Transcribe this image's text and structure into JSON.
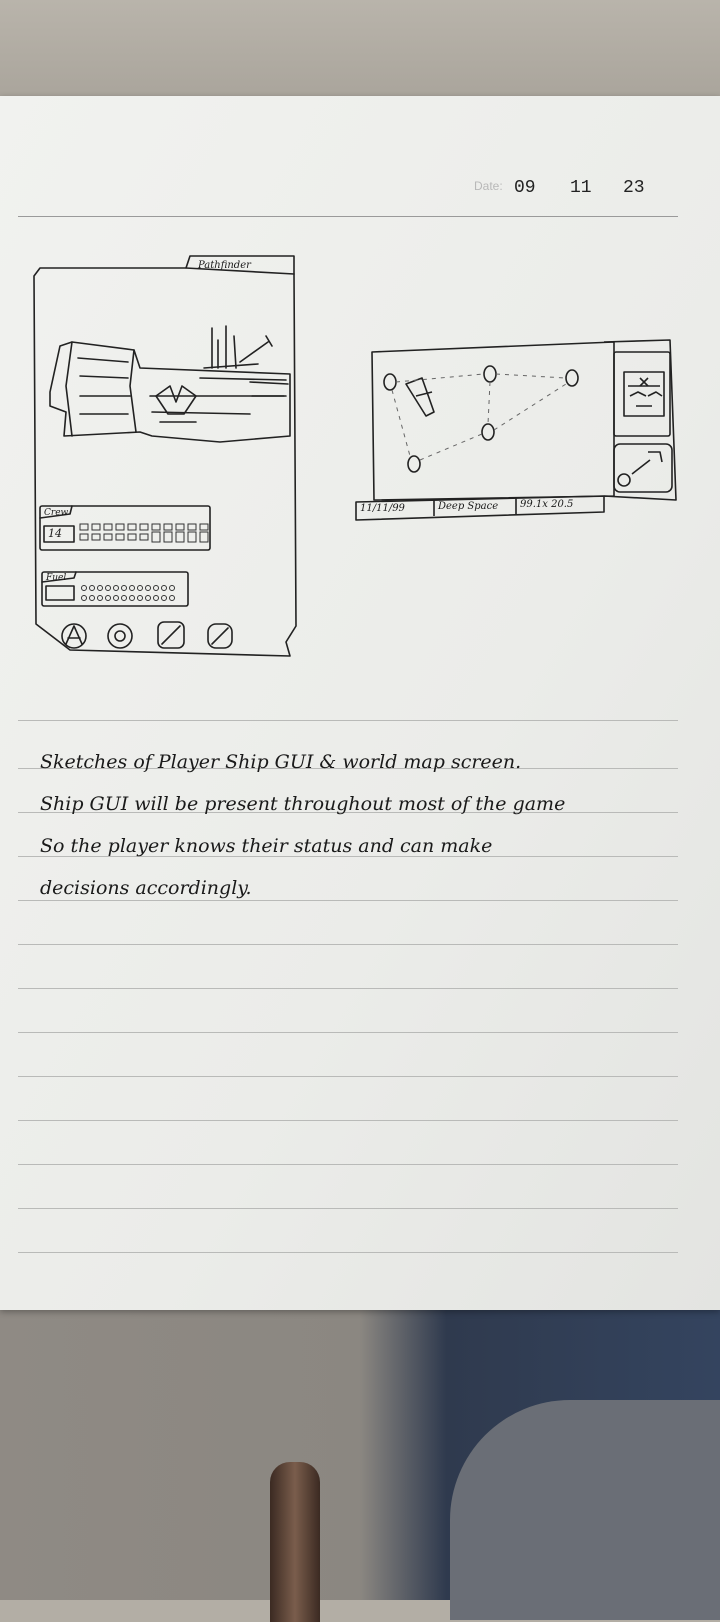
{
  "header": {
    "date_label": "Date:",
    "date_day": "09",
    "date_month": "11",
    "date_year": "23"
  },
  "ship_gui": {
    "title": "Pathfinder",
    "crew_label": "Crew",
    "crew_count": "14",
    "fuel_label": "Fuel"
  },
  "world_map": {
    "status_date": "11/11/99",
    "status_location": "Deep Space",
    "status_coords": "99.1x 20.5"
  },
  "notes": [
    "Sketches of Player Ship GUI & world map screen.",
    "Ship GUI will be present throughout most of the game",
    "So the player knows their status and can make",
    "decisions accordingly."
  ]
}
